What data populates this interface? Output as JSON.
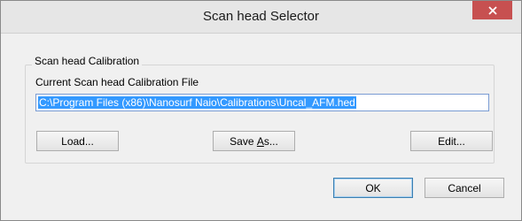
{
  "window": {
    "title": "Scan head Selector",
    "close_icon": "close-icon"
  },
  "group": {
    "legend": "Scan head Calibration",
    "field_label": "Current Scan head Calibration File",
    "file_path": "C:\\Program Files (x86)\\Nanosurf Naio\\Calibrations\\Uncal_AFM.hed"
  },
  "buttons": {
    "load": "Load...",
    "save_as_pre": "Save ",
    "save_as_mnemonic": "A",
    "save_as_post": "s...",
    "edit": "Edit...",
    "ok": "OK",
    "cancel": "Cancel"
  },
  "colors": {
    "close_button": "#c75050",
    "selection": "#3399ff",
    "default_button_border": "#3c7fb1"
  }
}
